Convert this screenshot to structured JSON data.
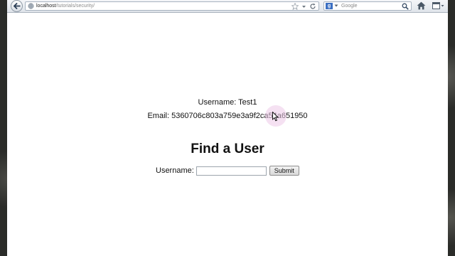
{
  "browser": {
    "url_host": "localhost",
    "url_path": "/tutorials/security/",
    "search_placeholder": "Google",
    "search_engine_letter": "g"
  },
  "page": {
    "username_label": "Username:",
    "username_value": "Test1",
    "email_label": "Email:",
    "email_value": "5360706c803a759e3a9f2ca54a651950",
    "find_title": "Find a User",
    "form_label": "Username:",
    "input_value": "",
    "submit_label": "Submit"
  }
}
